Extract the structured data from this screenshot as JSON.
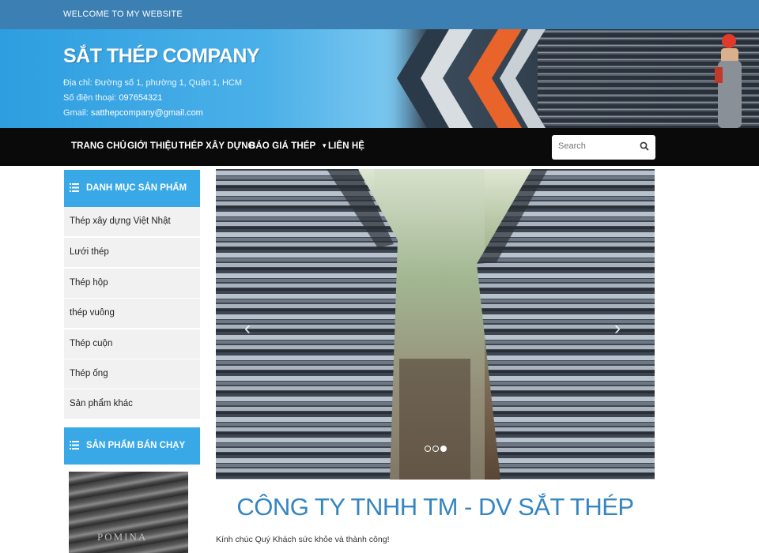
{
  "topbar": {
    "welcome": "WELCOME TO MY WEBSITE"
  },
  "header": {
    "title": "SẮT THÉP COMPANY",
    "address": "Địa chỉ: Đường số 1, phường 1, Quận 1, HCM",
    "phone_label": "Số điện thoại:",
    "phone": "097654321",
    "email_label": "Gmail:",
    "email": "satthepcompany@gmail.com"
  },
  "nav": {
    "items": [
      "TRANG CHỦ",
      "GIỚI THIỆU",
      "THÉP XÂY DỰNG",
      "BÁO GIÁ THÉP",
      "LIÊN HỆ"
    ],
    "search_placeholder": "Search"
  },
  "sidebar": {
    "category_title": "DANH MỤC SẢN PHẨM",
    "categories": [
      "Thép xây dựng Việt Nhật",
      "Lưới thép",
      "Thép hộp",
      "thép vuông",
      "Thép cuộn",
      "Thép ống",
      "Sản phẩm khác"
    ],
    "bestseller_title": "SẢN PHẨM BÁN CHẠY",
    "bestseller_image_text": "POMINA"
  },
  "slider": {
    "slide_count": 3,
    "active_slide": 3
  },
  "main": {
    "company_name": "CÔNG TY TNHH TM - DV SẮT THÉP",
    "greeting": "Kính chúc Quý Khách sức khỏe và thành công!"
  },
  "colors": {
    "topbar": "#3b7fb3",
    "accent": "#38a8e6",
    "navbar": "#0a0a0a",
    "heading": "#3585c1"
  }
}
